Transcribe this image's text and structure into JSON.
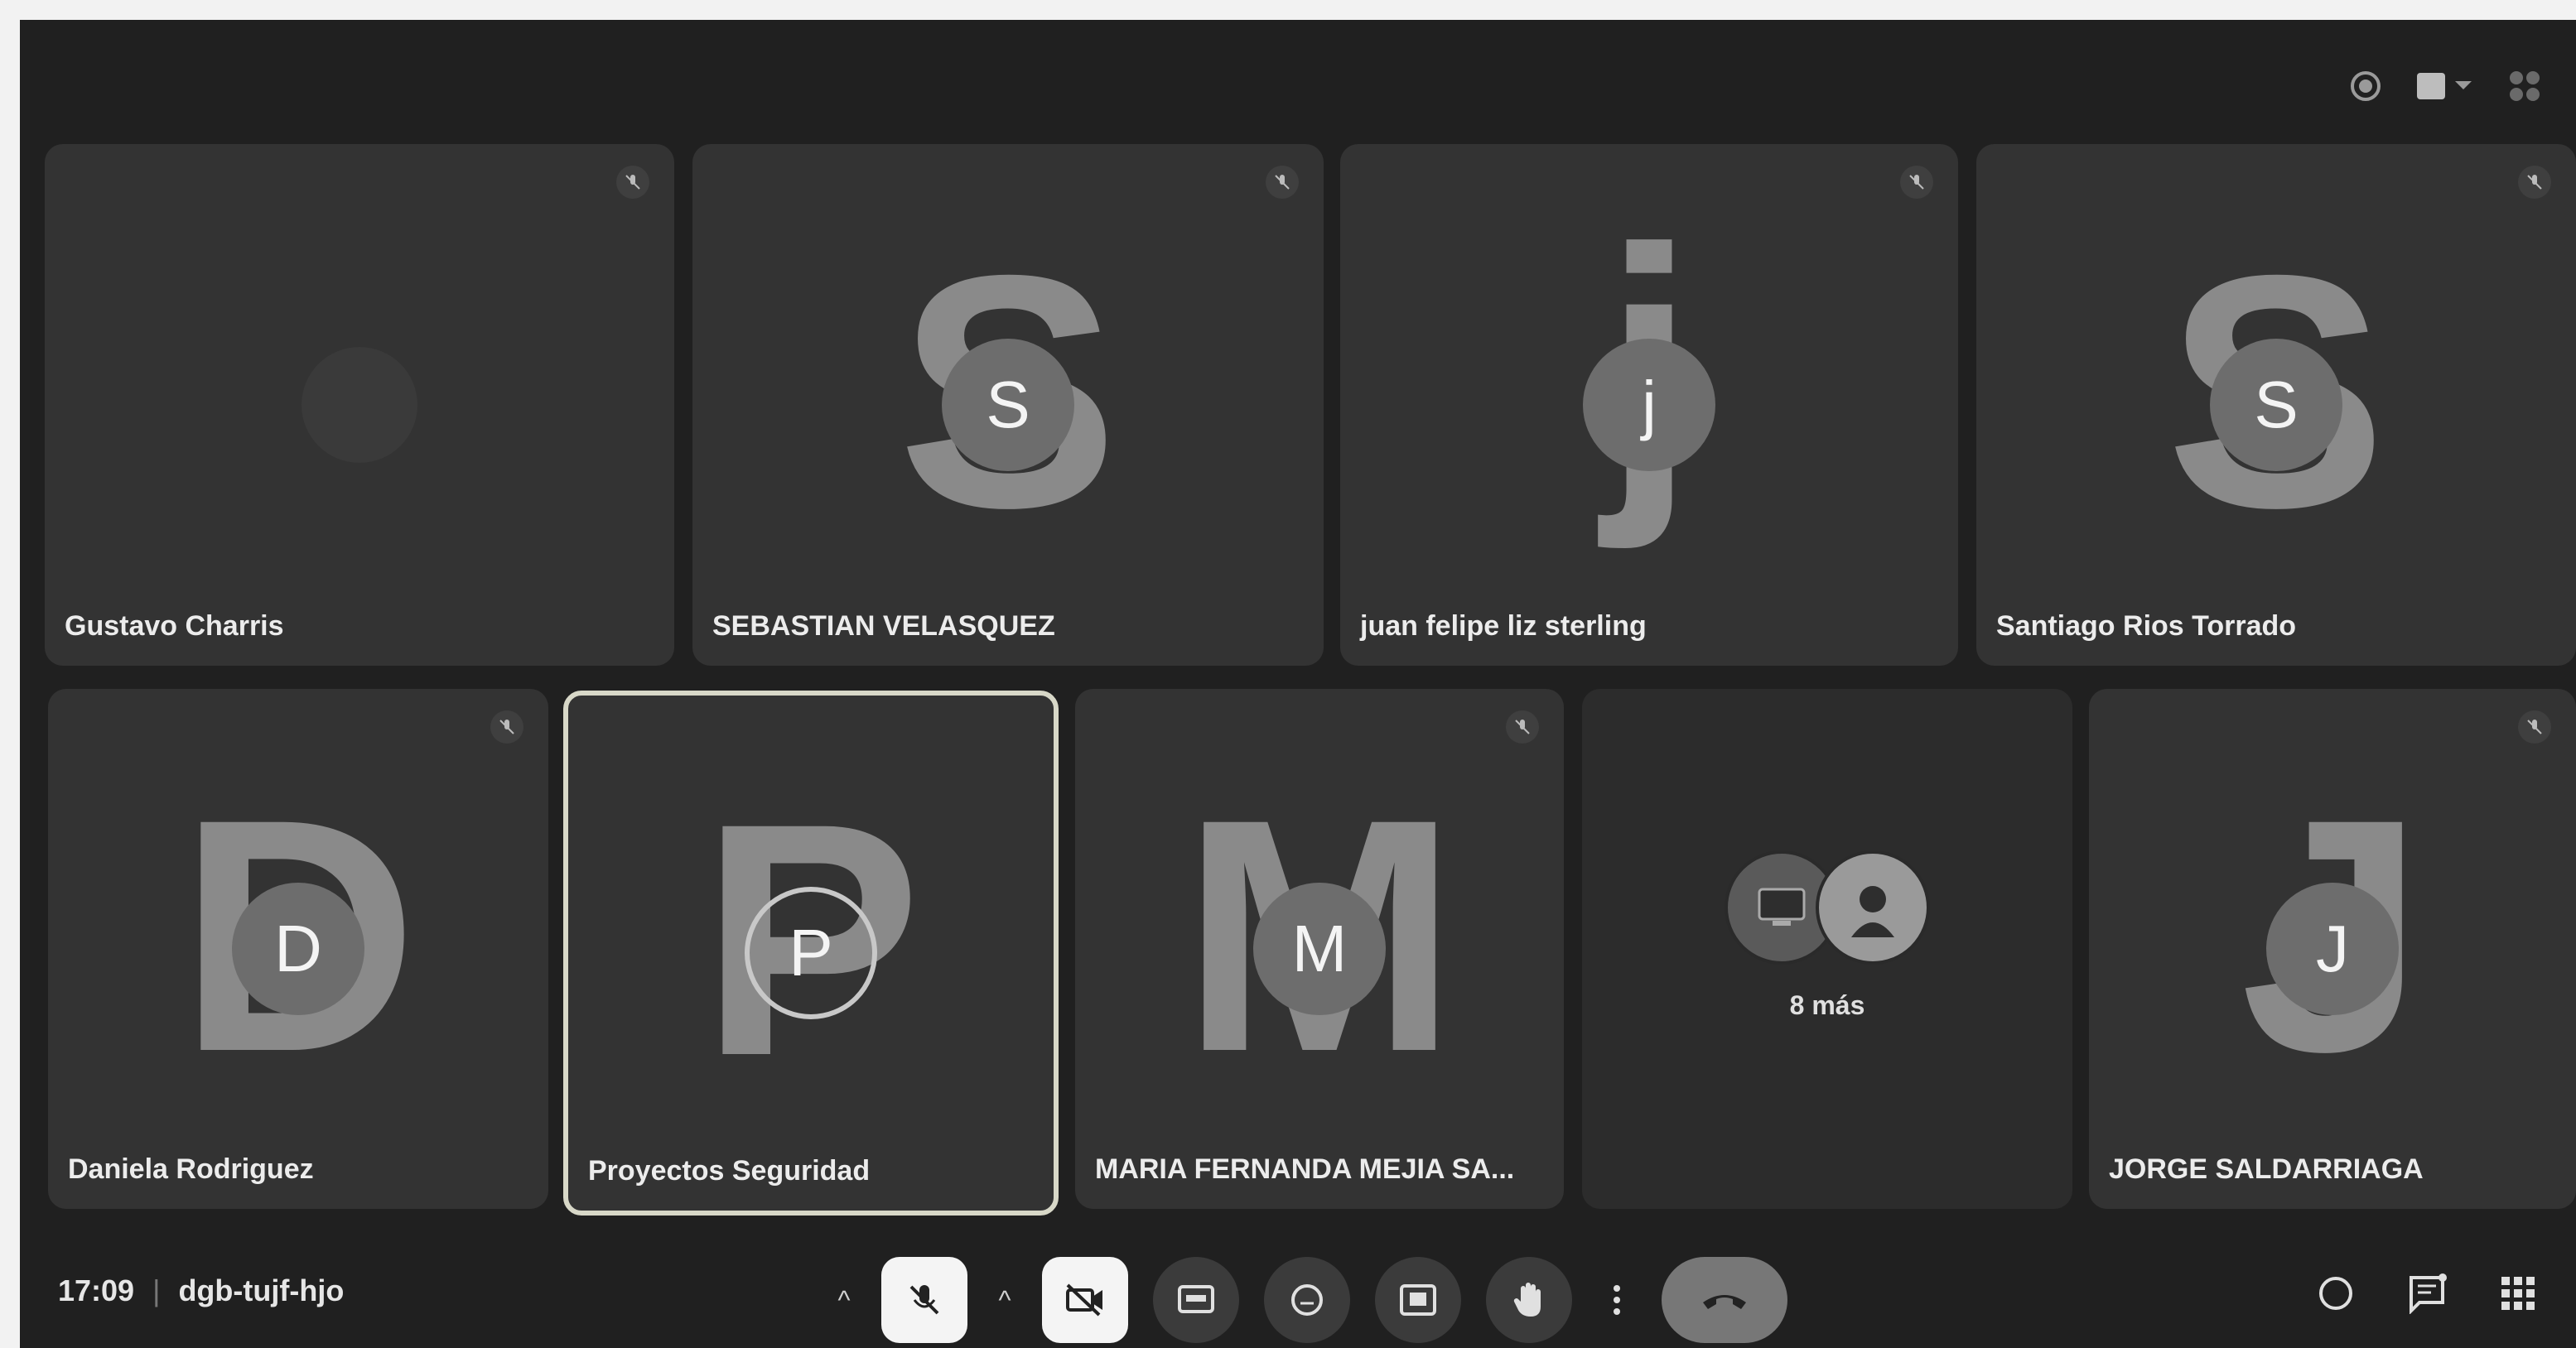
{
  "participants": [
    {
      "name": "Gustavo Charris",
      "letter": "",
      "initial": ""
    },
    {
      "name": "SEBASTIAN VELASQUEZ",
      "letter": "S",
      "initial": "S"
    },
    {
      "name": "juan felipe liz sterling",
      "letter": "j",
      "initial": "j"
    },
    {
      "name": "Santiago Rios Torrado",
      "letter": "S",
      "initial": "S"
    },
    {
      "name": "Daniela Rodriguez",
      "letter": "D",
      "initial": "D"
    },
    {
      "name": "Proyectos Seguridad",
      "letter": "P",
      "initial": "P"
    },
    {
      "name": "MARIA FERNANDA MEJIA SA...",
      "letter": "M",
      "initial": "M"
    },
    {
      "name": "JORGE SALDARRIAGA",
      "letter": "J",
      "initial": "J"
    }
  ],
  "more_tile": {
    "label": "8 más"
  },
  "meeting": {
    "time": "17:09",
    "separator": "|",
    "code": "dgb-tujf-hjo"
  },
  "icons": {
    "mic_muted": "mic-off-icon",
    "camera_off": "camera-off-icon",
    "captions": "captions-icon",
    "emoji": "emoji-icon",
    "present": "present-icon",
    "raise_hand": "hand-icon",
    "more": "more-options-icon",
    "end_call": "end-call-icon",
    "info": "info-icon",
    "chat": "chat-icon",
    "activities": "apps-icon"
  },
  "colors": {
    "background": "#202020",
    "tile": "#333333",
    "end_call": "#777777"
  }
}
